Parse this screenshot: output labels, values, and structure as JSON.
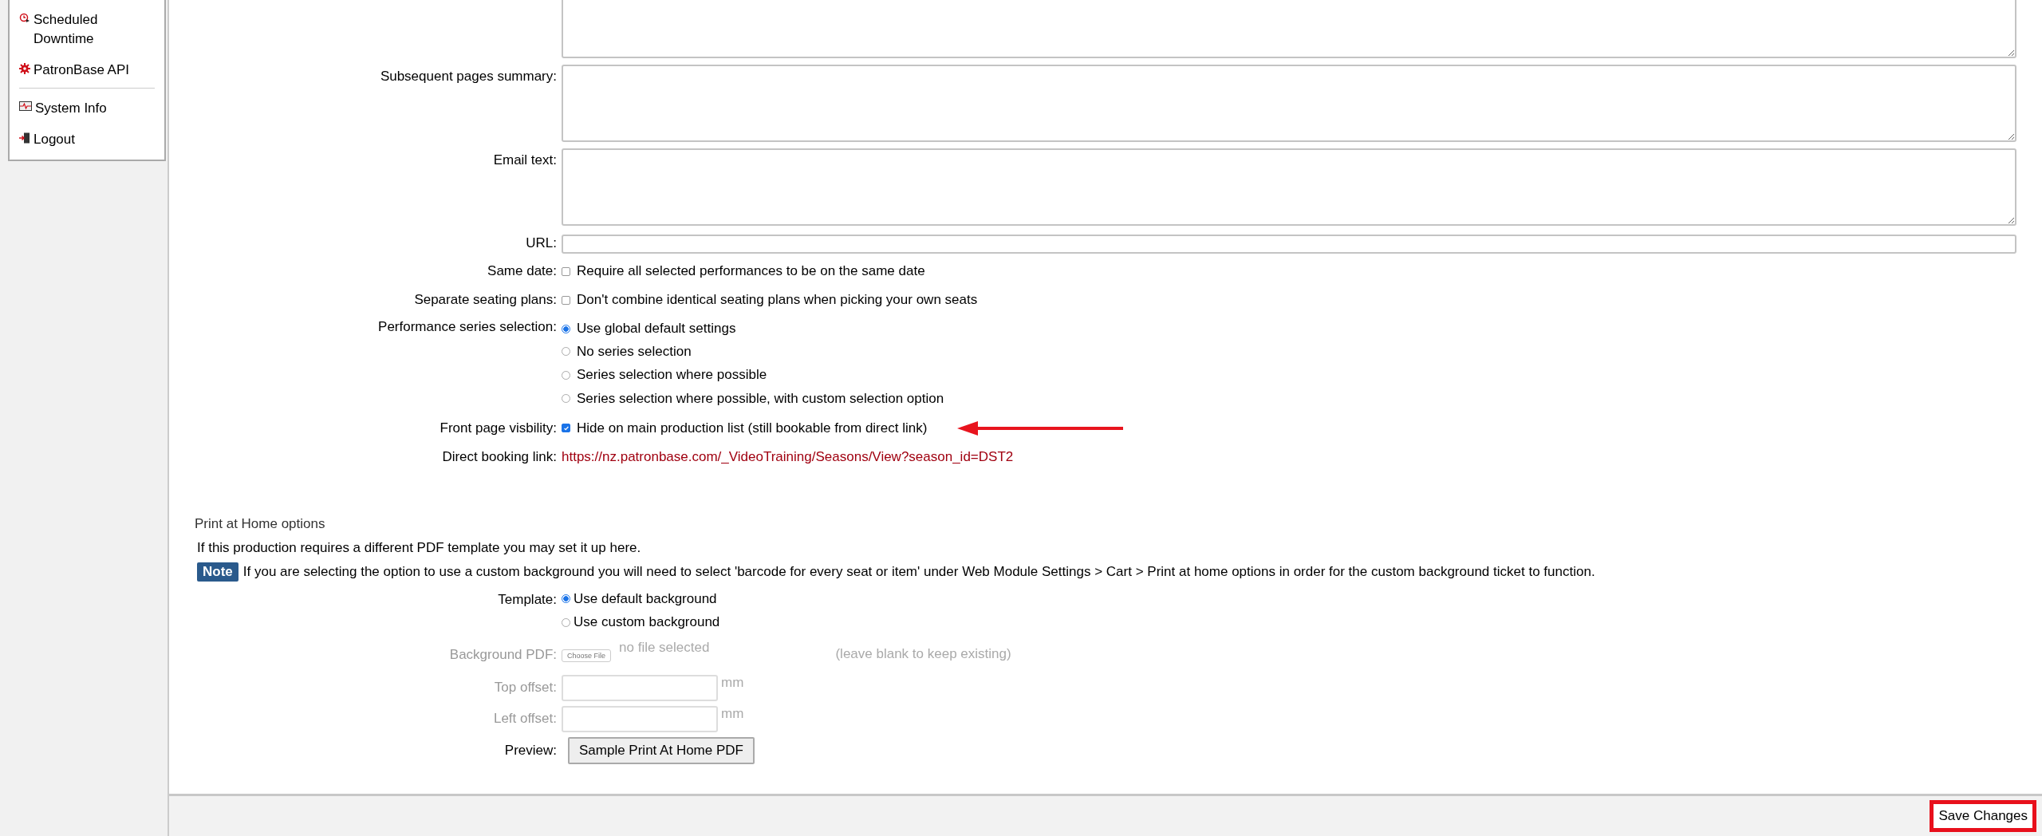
{
  "sidebar": {
    "groups": [
      [
        {
          "label": "Scheduled Downtime"
        },
        {
          "label": "PatronBase API"
        }
      ],
      [
        {
          "label": "System Info"
        },
        {
          "label": "Logout"
        }
      ]
    ]
  },
  "form": {
    "fields": [
      {
        "kind": "textarea"
      },
      {
        "kind": "textarea",
        "label": "Subsequent pages summary:"
      },
      {
        "kind": "textarea",
        "label": "Email text:"
      },
      {
        "kind": "text",
        "label": "URL:"
      },
      {
        "kind": "checkbox",
        "label": "Same date:",
        "option": "Require all selected performances to be on the same date",
        "checked": false
      },
      {
        "kind": "checkbox",
        "label": "Separate seating plans:",
        "option": "Don't combine identical seating plans when picking your own seats",
        "checked": false
      },
      {
        "kind": "radio",
        "label": "Performance series selection:",
        "options": [
          {
            "label": "Use global default settings",
            "selected": true
          },
          {
            "label": "No series selection",
            "selected": false
          },
          {
            "label": "Series selection where possible",
            "selected": false
          },
          {
            "label": "Series selection where possible, with custom selection option",
            "selected": false
          }
        ]
      },
      {
        "kind": "checkbox",
        "label": "Front page visbility:",
        "option": "Hide on main production list (still bookable from direct link)",
        "checked": true,
        "annotated": true
      },
      {
        "kind": "link",
        "label": "Direct booking link:",
        "url": "https://nz.patronbase.com/_VideoTraining/Seasons/View?season_id=DST2"
      }
    ]
  },
  "print_at_home": {
    "heading": "Print at Home options",
    "intro": "If this production requires a different PDF template you may set it up here.",
    "note": {
      "badge": "Note",
      "text": "If you are selecting the option to use a custom background you will need to select 'barcode for every seat or item' under Web Module Settings > Cart > Print at home options in order for the custom background ticket to function."
    },
    "fields": [
      {
        "kind": "radio",
        "label": "Template:",
        "options": [
          {
            "label": "Use default background",
            "selected": true
          },
          {
            "label": "Use custom background",
            "selected": false
          }
        ]
      },
      {
        "kind": "file",
        "label": "Background PDF:",
        "button": "Choose File",
        "status": "no file selected",
        "hint": "(leave blank to keep existing)",
        "disabled": true
      },
      {
        "kind": "number",
        "label": "Top offset:",
        "unit": "mm",
        "disabled": true
      },
      {
        "kind": "number",
        "label": "Left offset:",
        "unit": "mm",
        "disabled": true
      },
      {
        "kind": "button",
        "label": "Preview:",
        "button": "Sample Print At Home PDF"
      }
    ]
  },
  "footer": {
    "save_button": "Save Changes",
    "highlighted": true
  }
}
